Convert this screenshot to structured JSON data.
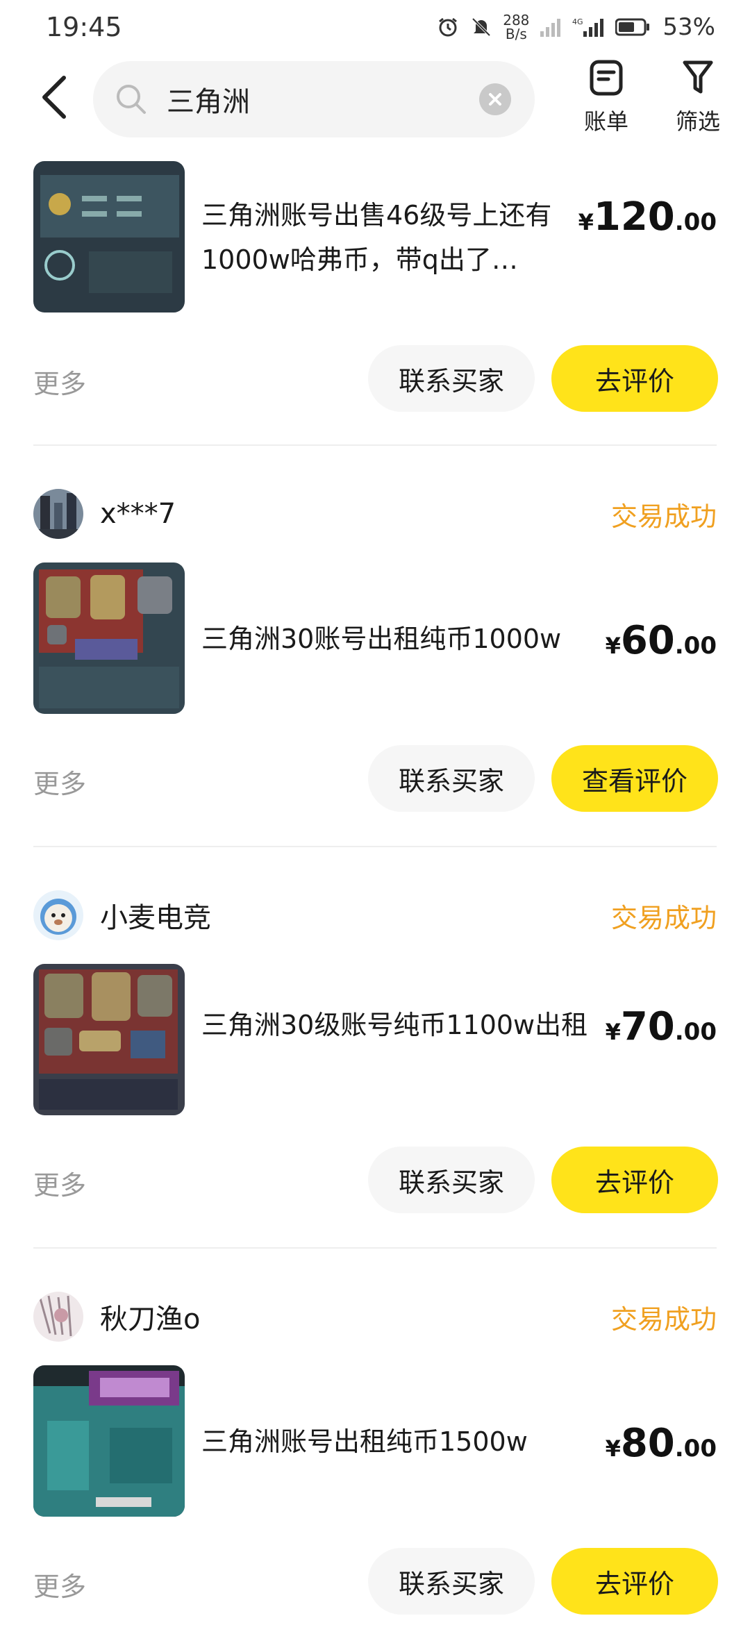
{
  "status_bar": {
    "time": "19:45",
    "speed_value": "288",
    "speed_unit": "B/s",
    "network": "4G",
    "battery": "53%"
  },
  "header": {
    "search_text": "三角洲",
    "bill_label": "账单",
    "filter_label": "筛选"
  },
  "orders": [
    {
      "seller": "",
      "status": "",
      "title": "三角洲账号出售46级号上还有1000w哈弗币，带q出了…",
      "price_currency": "¥",
      "price_int": "120",
      "price_dec": ".00",
      "more": "更多",
      "contact": "联系买家",
      "eval": "去评价"
    },
    {
      "seller": "x***7",
      "status": "交易成功",
      "title": "三角洲30账号出租纯币1000w",
      "price_currency": "¥",
      "price_int": "60",
      "price_dec": ".00",
      "more": "更多",
      "contact": "联系买家",
      "eval": "查看评价"
    },
    {
      "seller": "小麦电竞",
      "status": "交易成功",
      "title": "三角洲30级账号纯币1100w出租",
      "price_currency": "¥",
      "price_int": "70",
      "price_dec": ".00",
      "more": "更多",
      "contact": "联系买家",
      "eval": "去评价"
    },
    {
      "seller": "秋刀渔o",
      "status": "交易成功",
      "title": "三角洲账号出租纯币1500w",
      "price_currency": "¥",
      "price_int": "80",
      "price_dec": ".00",
      "more": "更多",
      "contact": "联系买家",
      "eval": "去评价"
    }
  ],
  "colors": {
    "accent_yellow": "#ffe31a",
    "status_orange": "#f0a020",
    "muted_gray": "#999999"
  }
}
